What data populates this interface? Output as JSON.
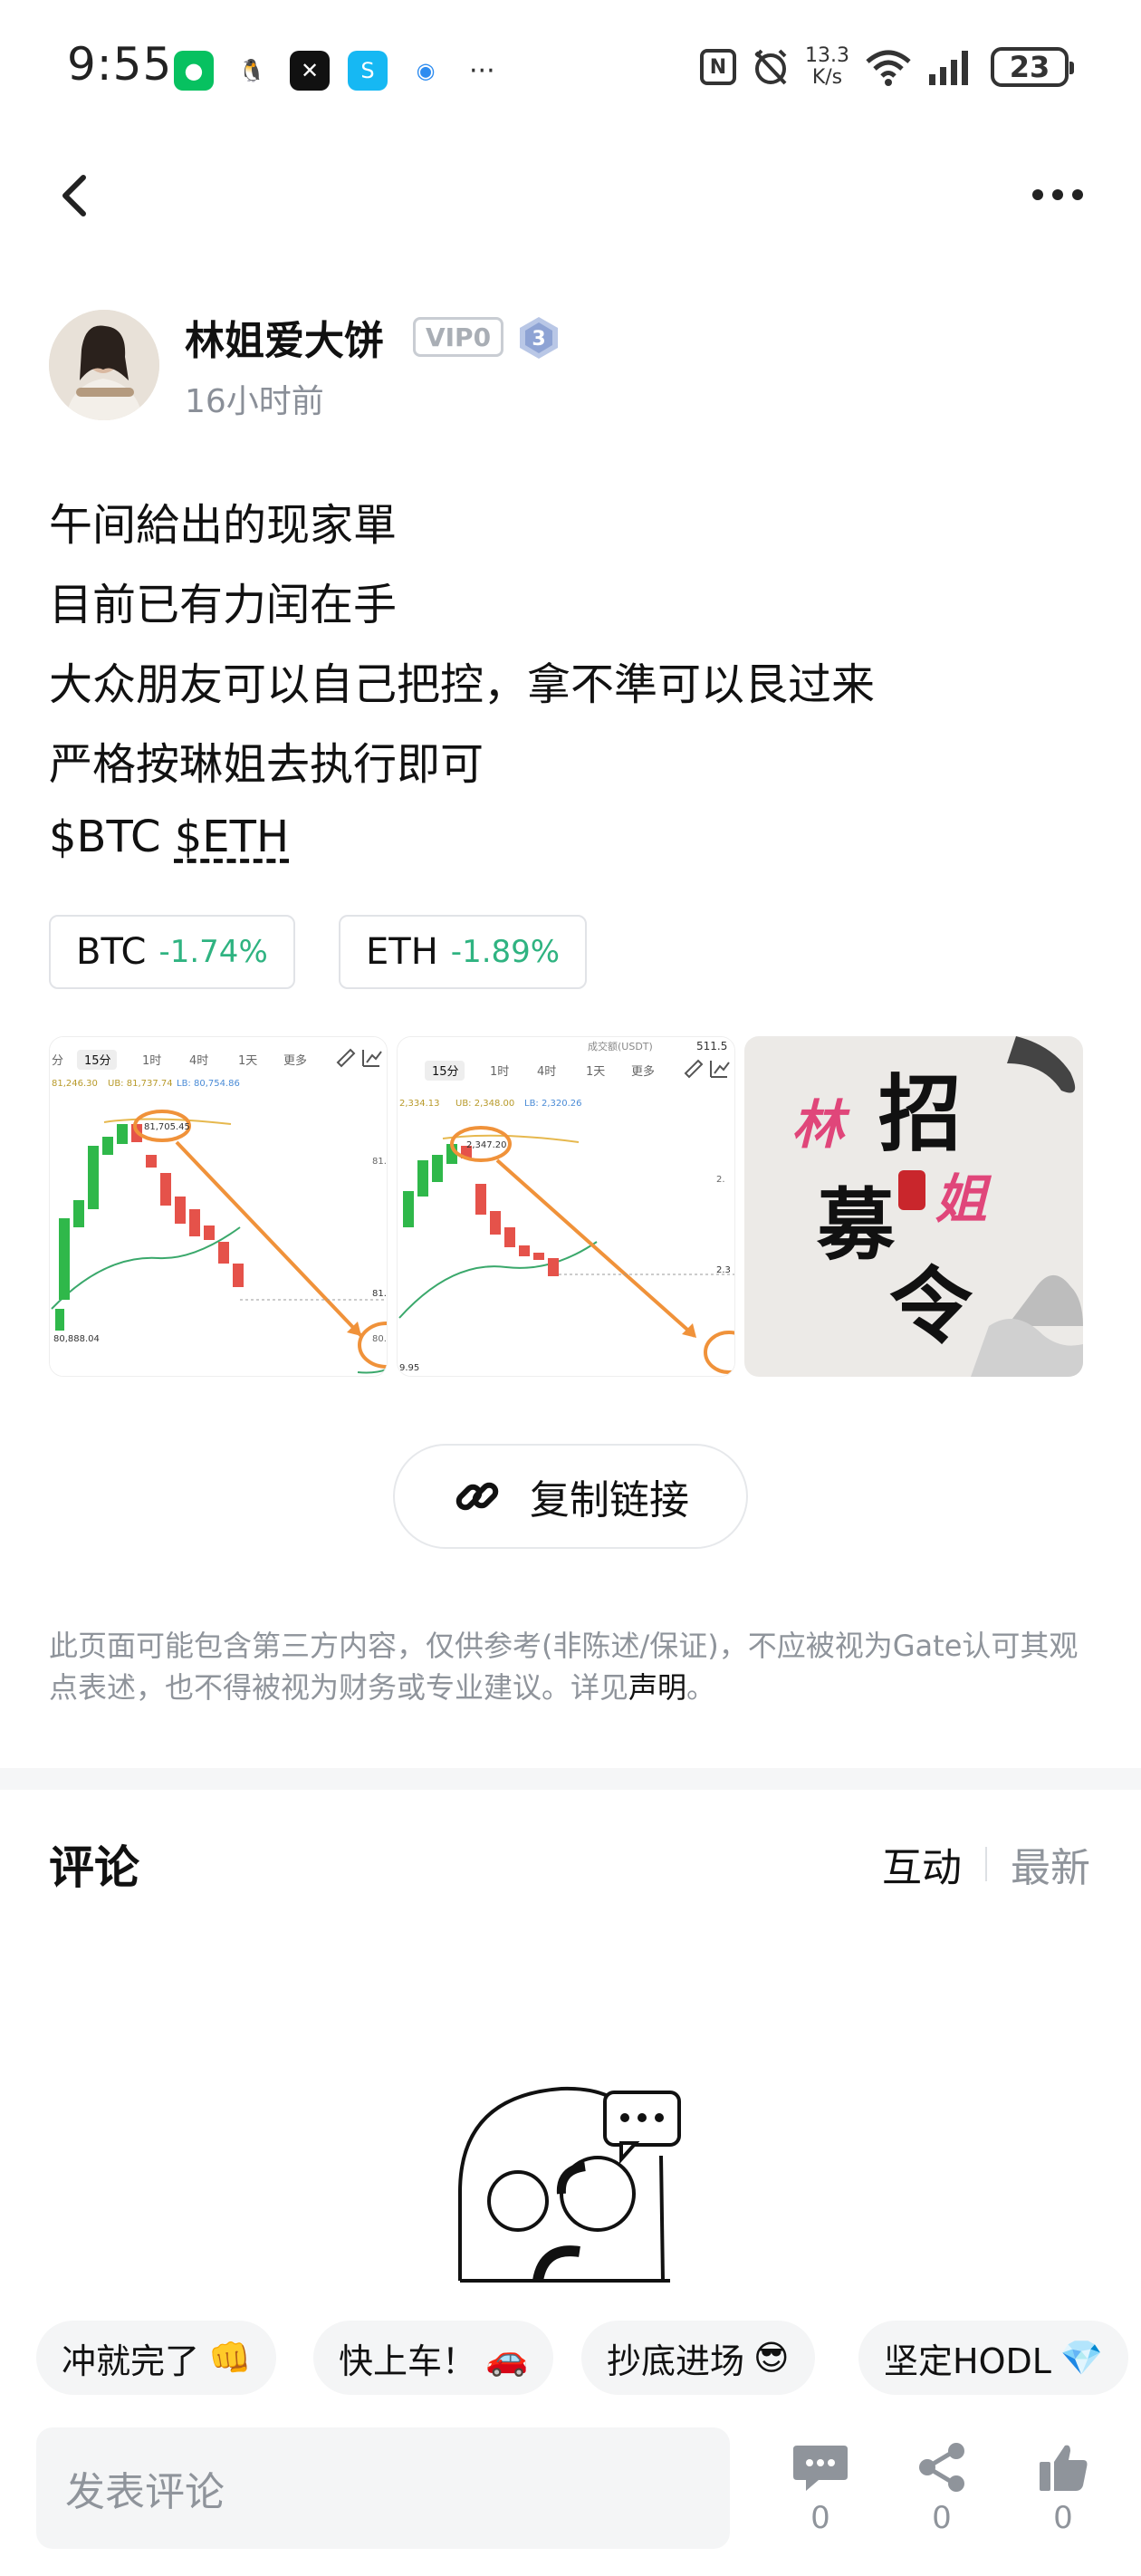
{
  "status_bar": {
    "time": "9:55",
    "net_speed_value": "13.3",
    "net_speed_unit": "K/s",
    "battery": "23",
    "overflow": "···"
  },
  "author": {
    "name": "林姐爱大饼",
    "vip": "VIP0",
    "level": "3",
    "time": "16小时前"
  },
  "post": {
    "lines": [
      "午间給出的现家單",
      "目前已有力闰在手",
      "大众朋友可以自己把控，拿不準可以艮过来",
      "严格按琳姐去执行即可"
    ],
    "tags": [
      "$BTC",
      "$ETH"
    ]
  },
  "coins": [
    {
      "name": "BTC",
      "change": "-1.74%"
    },
    {
      "name": "ETH",
      "change": "-1.89%"
    }
  ],
  "images": {
    "chart1": {
      "tabs": [
        "分",
        "15分",
        "1时",
        "4时",
        "1天",
        "更多"
      ],
      "ub": "UB: 81,737.74",
      "lb": "LB: 80,754.86",
      "mb": "81,246.30",
      "peak": "81,705.45",
      "low": "80,888.04",
      "y1": "81.",
      "y2": "81.",
      "y3": "80."
    },
    "chart2": {
      "tabs": [
        "15分",
        "1时",
        "4时",
        "1天",
        "更多"
      ],
      "header_label": "成交额(USDT)",
      "header_value": "511.5",
      "ub": "UB: 2,348.00",
      "lb": "LB: 2,320.26",
      "mb": "2,334.13",
      "peak": "2,347.20",
      "bottom": "9.95",
      "y1": "2.",
      "y2": "2.3"
    },
    "poster": {
      "chars": [
        "林",
        "招",
        "募",
        "姐",
        "令"
      ]
    }
  },
  "actions": {
    "copy_link": "复制链接"
  },
  "disclaimer": {
    "text": "此页面可能包含第三方内容，仅供参考(非陈述/保证)，不应被视为Gate认可其观点表述，也不得被视为财务或专业建议。详见",
    "link": "声明",
    "end": "。"
  },
  "comments": {
    "title": "评论",
    "sort_active": "互动",
    "sort_inactive": "最新"
  },
  "quick_replies": [
    {
      "text": "冲就完了",
      "emoji": "👊"
    },
    {
      "text": "快上车！",
      "emoji": "🚗"
    },
    {
      "text": "抄底进场",
      "emoji": "😎"
    },
    {
      "text": "坚定HODL",
      "emoji": "💎"
    }
  ],
  "bottom_bar": {
    "placeholder": "发表评论",
    "comment_count": "0",
    "share_count": "0",
    "like_count": "0"
  },
  "colors": {
    "up": "#2fb381",
    "down": "#e5524a",
    "accent_orange": "#f0923a"
  }
}
